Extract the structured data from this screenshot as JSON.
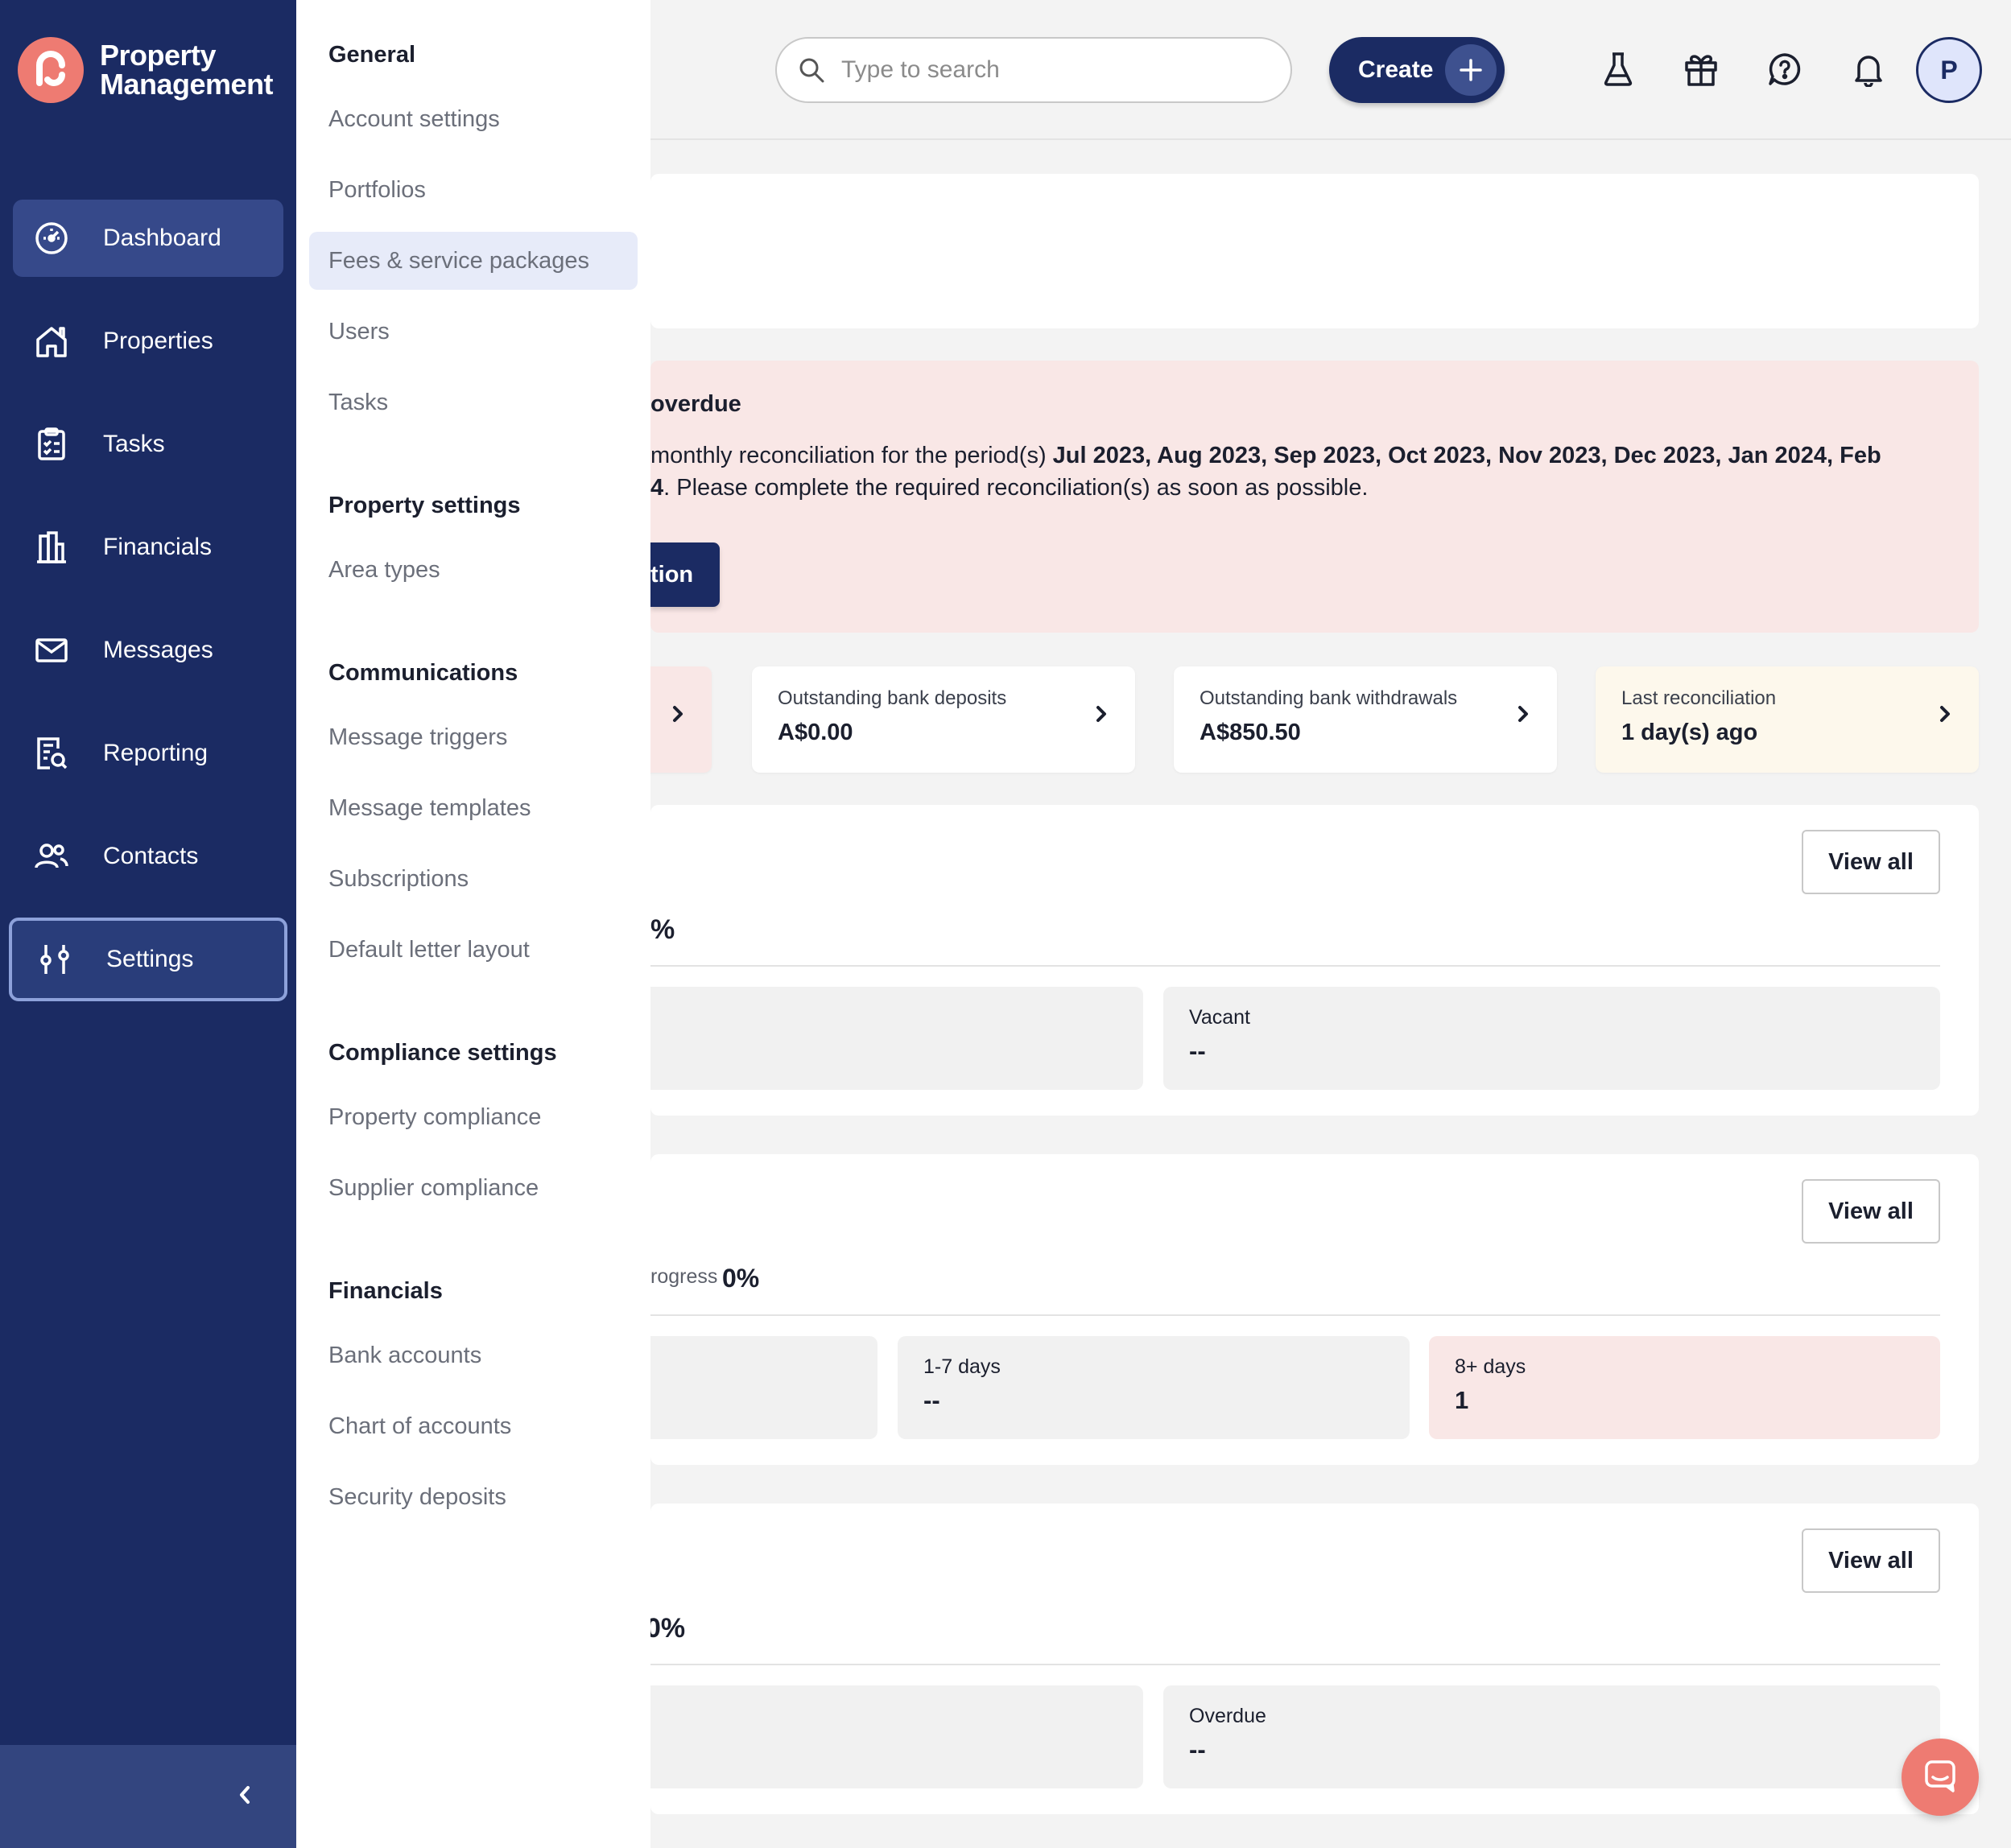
{
  "app": {
    "brand_line1": "Property",
    "brand_line2": "Management",
    "accent": "#1b2b63",
    "brand_color": "#ee7b72"
  },
  "sidebar": {
    "items": [
      {
        "label": "Dashboard",
        "icon": "dashboard-icon"
      },
      {
        "label": "Properties",
        "icon": "home-icon"
      },
      {
        "label": "Tasks",
        "icon": "clipboard-icon"
      },
      {
        "label": "Financials",
        "icon": "buildings-icon"
      },
      {
        "label": "Messages",
        "icon": "envelope-icon"
      },
      {
        "label": "Reporting",
        "icon": "report-search-icon"
      },
      {
        "label": "Contacts",
        "icon": "users-icon"
      },
      {
        "label": "Settings",
        "icon": "sliders-icon"
      }
    ],
    "active": "Dashboard",
    "selected": "Settings",
    "collapse_icon": "chevron-left-icon"
  },
  "settings_menu": {
    "sections": [
      {
        "heading": "General",
        "items": [
          "Account settings",
          "Portfolios",
          "Fees & service packages",
          "Users",
          "Tasks"
        ]
      },
      {
        "heading": "Property settings",
        "items": [
          "Area types"
        ]
      },
      {
        "heading": "Communications",
        "items": [
          "Message triggers",
          "Message templates",
          "Subscriptions",
          "Default letter layout"
        ]
      },
      {
        "heading": "Compliance settings",
        "items": [
          "Property compliance",
          "Supplier compliance"
        ]
      },
      {
        "heading": "Financials",
        "items": [
          "Bank accounts",
          "Chart of accounts",
          "Security deposits"
        ]
      }
    ],
    "highlighted": "Fees & service packages"
  },
  "topbar": {
    "search_placeholder": "Type to search",
    "create_label": "Create",
    "icons": [
      "flask-icon",
      "gift-icon",
      "help-icon",
      "bell-icon"
    ],
    "avatar_initial": "P"
  },
  "alert": {
    "title_partial": "overdue",
    "text_prefix": "monthly reconciliation for the period(s) ",
    "periods": "Jul 2023, Aug 2023, Sep 2023, Oct 2023, Nov 2023, Dec 2023, Jan 2024, Feb",
    "line2_bold": "4",
    "line2_rest": ". Please complete the required reconciliation(s) as soon as possible.",
    "button_partial": "tion"
  },
  "stats": [
    {
      "label": "Outstanding bank deposits",
      "value": "A$0.00"
    },
    {
      "label": "Outstanding bank withdrawals",
      "value": "A$850.50"
    },
    {
      "label": "Last reconciliation",
      "value": "1 day(s) ago"
    }
  ],
  "section1": {
    "view_all": "View all",
    "metric_partial": "%",
    "tile_label": "Vacant",
    "tile_value": "--"
  },
  "section2": {
    "view_all": "View all",
    "metric_prefix": "rogress",
    "metric_value": "0%",
    "tiles": [
      {
        "label": "1-7 days",
        "value": "--"
      },
      {
        "label": "8+ days",
        "value": "1"
      }
    ]
  },
  "section3": {
    "view_all": "View all",
    "metric_partial": "0%",
    "tile_label": "Overdue",
    "tile_value": "--"
  }
}
